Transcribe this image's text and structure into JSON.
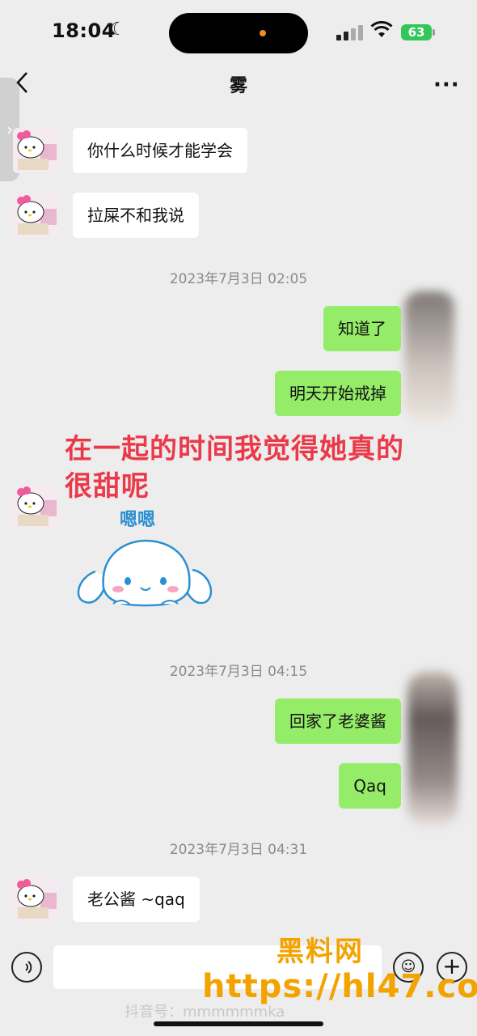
{
  "status_bar": {
    "time": "18:04",
    "battery": "63",
    "moon_icon": "moon-icon",
    "wifi_icon": "wifi-icon",
    "signal_icon": "cellular-signal-icon"
  },
  "nav": {
    "title": "雾",
    "back_icon": "chevron-left-icon",
    "more_icon": "more-icon"
  },
  "messages": [
    {
      "side": "in",
      "text": "你什么时候才能学会"
    },
    {
      "side": "in",
      "text": "拉屎不和我说"
    },
    {
      "type": "time",
      "text": "2023年7月3日 02:05"
    },
    {
      "side": "out",
      "text": "知道了"
    },
    {
      "side": "out",
      "text": "明天开始戒掉"
    },
    {
      "side": "in",
      "type": "sticker",
      "sticker_text": "嗯嗯",
      "sticker_icon": "cinnamoroll-sticker"
    },
    {
      "type": "time",
      "text": "2023年7月3日 04:15"
    },
    {
      "side": "out",
      "text": "回家了老婆酱"
    },
    {
      "side": "out",
      "text": "Qaq"
    },
    {
      "type": "time",
      "text": "2023年7月3日 04:31"
    },
    {
      "side": "in",
      "text": "老公酱 ~qaq"
    }
  ],
  "overlay_caption": "在一起的时间我觉得她真的很甜呢",
  "input_bar": {
    "voice_icon": "voice-icon",
    "emoji_icon": "emoji-icon",
    "plus_icon": "plus-icon"
  },
  "watermarks": {
    "site": "黑料网",
    "url": "https://hl47.co",
    "tiktok": "抖音号：mmmmmmka"
  },
  "colors": {
    "outgoing_bubble": "#95ec69",
    "incoming_bubble": "#ffffff",
    "background": "#ededed",
    "caption": "#ea3a4a",
    "watermark": "#f3a300"
  }
}
